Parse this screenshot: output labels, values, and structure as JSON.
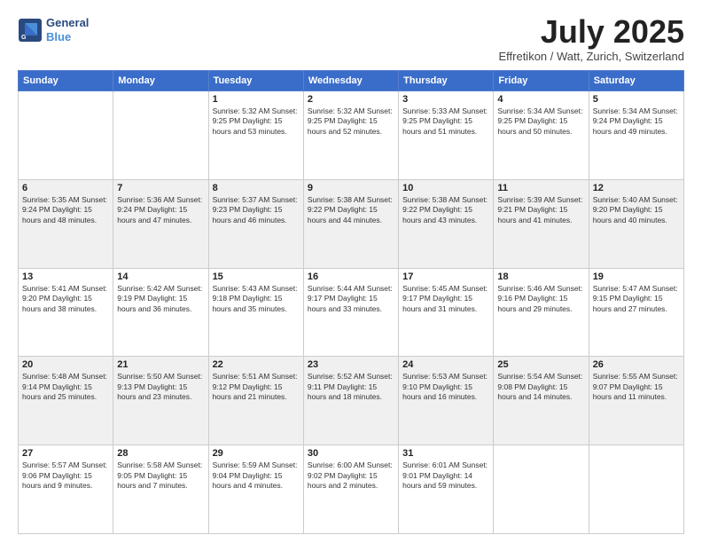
{
  "header": {
    "logo_line1": "General",
    "logo_line2": "Blue",
    "month": "July 2025",
    "location": "Effretikon / Watt, Zurich, Switzerland"
  },
  "weekdays": [
    "Sunday",
    "Monday",
    "Tuesday",
    "Wednesday",
    "Thursday",
    "Friday",
    "Saturday"
  ],
  "weeks": [
    [
      {
        "day": "",
        "info": ""
      },
      {
        "day": "",
        "info": ""
      },
      {
        "day": "1",
        "info": "Sunrise: 5:32 AM\nSunset: 9:25 PM\nDaylight: 15 hours\nand 53 minutes."
      },
      {
        "day": "2",
        "info": "Sunrise: 5:32 AM\nSunset: 9:25 PM\nDaylight: 15 hours\nand 52 minutes."
      },
      {
        "day": "3",
        "info": "Sunrise: 5:33 AM\nSunset: 9:25 PM\nDaylight: 15 hours\nand 51 minutes."
      },
      {
        "day": "4",
        "info": "Sunrise: 5:34 AM\nSunset: 9:25 PM\nDaylight: 15 hours\nand 50 minutes."
      },
      {
        "day": "5",
        "info": "Sunrise: 5:34 AM\nSunset: 9:24 PM\nDaylight: 15 hours\nand 49 minutes."
      }
    ],
    [
      {
        "day": "6",
        "info": "Sunrise: 5:35 AM\nSunset: 9:24 PM\nDaylight: 15 hours\nand 48 minutes."
      },
      {
        "day": "7",
        "info": "Sunrise: 5:36 AM\nSunset: 9:24 PM\nDaylight: 15 hours\nand 47 minutes."
      },
      {
        "day": "8",
        "info": "Sunrise: 5:37 AM\nSunset: 9:23 PM\nDaylight: 15 hours\nand 46 minutes."
      },
      {
        "day": "9",
        "info": "Sunrise: 5:38 AM\nSunset: 9:22 PM\nDaylight: 15 hours\nand 44 minutes."
      },
      {
        "day": "10",
        "info": "Sunrise: 5:38 AM\nSunset: 9:22 PM\nDaylight: 15 hours\nand 43 minutes."
      },
      {
        "day": "11",
        "info": "Sunrise: 5:39 AM\nSunset: 9:21 PM\nDaylight: 15 hours\nand 41 minutes."
      },
      {
        "day": "12",
        "info": "Sunrise: 5:40 AM\nSunset: 9:20 PM\nDaylight: 15 hours\nand 40 minutes."
      }
    ],
    [
      {
        "day": "13",
        "info": "Sunrise: 5:41 AM\nSunset: 9:20 PM\nDaylight: 15 hours\nand 38 minutes."
      },
      {
        "day": "14",
        "info": "Sunrise: 5:42 AM\nSunset: 9:19 PM\nDaylight: 15 hours\nand 36 minutes."
      },
      {
        "day": "15",
        "info": "Sunrise: 5:43 AM\nSunset: 9:18 PM\nDaylight: 15 hours\nand 35 minutes."
      },
      {
        "day": "16",
        "info": "Sunrise: 5:44 AM\nSunset: 9:17 PM\nDaylight: 15 hours\nand 33 minutes."
      },
      {
        "day": "17",
        "info": "Sunrise: 5:45 AM\nSunset: 9:17 PM\nDaylight: 15 hours\nand 31 minutes."
      },
      {
        "day": "18",
        "info": "Sunrise: 5:46 AM\nSunset: 9:16 PM\nDaylight: 15 hours\nand 29 minutes."
      },
      {
        "day": "19",
        "info": "Sunrise: 5:47 AM\nSunset: 9:15 PM\nDaylight: 15 hours\nand 27 minutes."
      }
    ],
    [
      {
        "day": "20",
        "info": "Sunrise: 5:48 AM\nSunset: 9:14 PM\nDaylight: 15 hours\nand 25 minutes."
      },
      {
        "day": "21",
        "info": "Sunrise: 5:50 AM\nSunset: 9:13 PM\nDaylight: 15 hours\nand 23 minutes."
      },
      {
        "day": "22",
        "info": "Sunrise: 5:51 AM\nSunset: 9:12 PM\nDaylight: 15 hours\nand 21 minutes."
      },
      {
        "day": "23",
        "info": "Sunrise: 5:52 AM\nSunset: 9:11 PM\nDaylight: 15 hours\nand 18 minutes."
      },
      {
        "day": "24",
        "info": "Sunrise: 5:53 AM\nSunset: 9:10 PM\nDaylight: 15 hours\nand 16 minutes."
      },
      {
        "day": "25",
        "info": "Sunrise: 5:54 AM\nSunset: 9:08 PM\nDaylight: 15 hours\nand 14 minutes."
      },
      {
        "day": "26",
        "info": "Sunrise: 5:55 AM\nSunset: 9:07 PM\nDaylight: 15 hours\nand 11 minutes."
      }
    ],
    [
      {
        "day": "27",
        "info": "Sunrise: 5:57 AM\nSunset: 9:06 PM\nDaylight: 15 hours\nand 9 minutes."
      },
      {
        "day": "28",
        "info": "Sunrise: 5:58 AM\nSunset: 9:05 PM\nDaylight: 15 hours\nand 7 minutes."
      },
      {
        "day": "29",
        "info": "Sunrise: 5:59 AM\nSunset: 9:04 PM\nDaylight: 15 hours\nand 4 minutes."
      },
      {
        "day": "30",
        "info": "Sunrise: 6:00 AM\nSunset: 9:02 PM\nDaylight: 15 hours\nand 2 minutes."
      },
      {
        "day": "31",
        "info": "Sunrise: 6:01 AM\nSunset: 9:01 PM\nDaylight: 14 hours\nand 59 minutes."
      },
      {
        "day": "",
        "info": ""
      },
      {
        "day": "",
        "info": ""
      }
    ]
  ]
}
